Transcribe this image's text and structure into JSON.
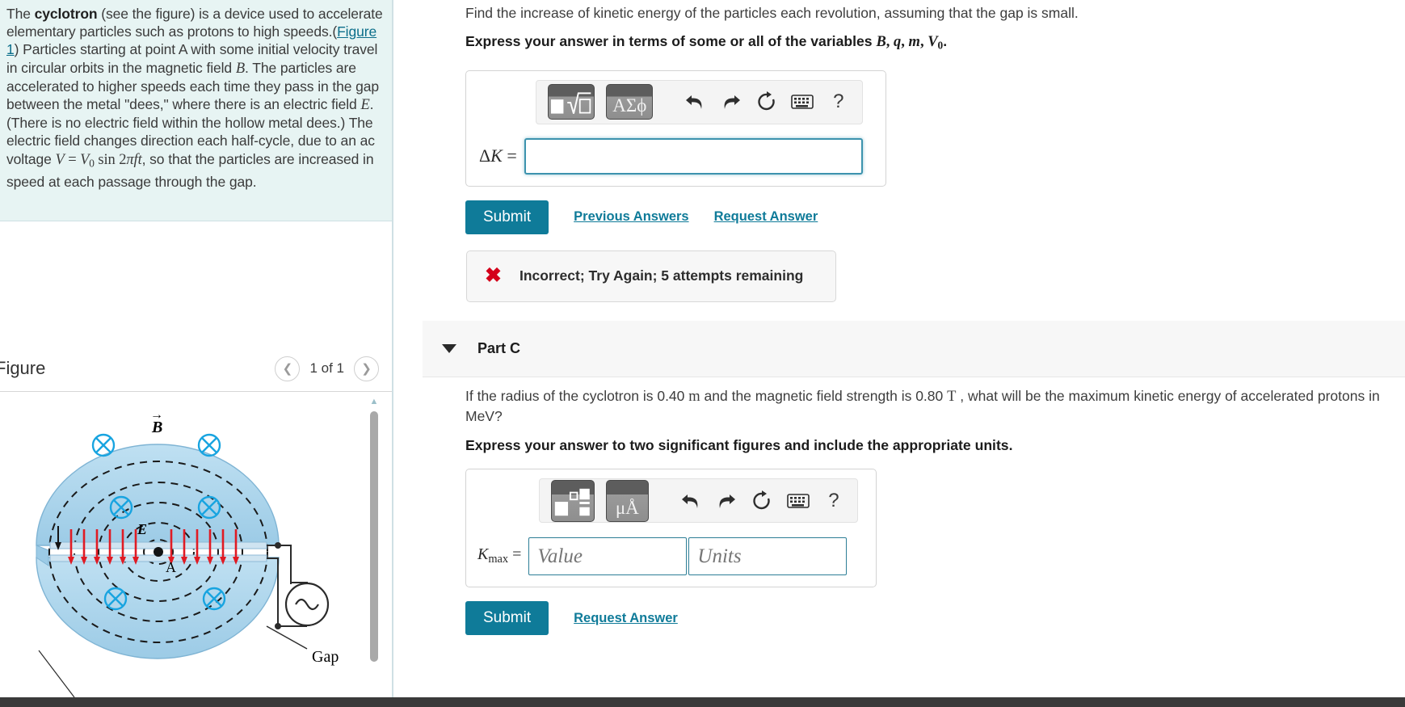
{
  "left": {
    "problem": {
      "intro_1": "The ",
      "bold_1": "cyclotron",
      "intro_2": " (see the figure) is a device used to accelerate elementary particles such as protons to high speeds.(",
      "figure_link": "Figure 1",
      "intro_3": ") Particles starting at point A with some initial velocity travel in circular orbits in the magnetic field ",
      "var_B": "B",
      "intro_4": ". The particles are accelerated to higher speeds each time they pass in the gap between the metal \"dees,\" where there is an electric field ",
      "var_E": "E",
      "intro_5": ". (There is no electric field within the hollow metal dees.) The electric field changes direction each half-cycle, due to an ac voltage ",
      "equation": "V = V0 sin 2πft",
      "intro_6": ", so that the particles are increased in speed at each passage through the gap."
    },
    "figure": {
      "title": "Figure",
      "prev_icon": "chevron-left-icon",
      "next_icon": "chevron-right-icon",
      "counter": "1 of 1",
      "labels": {
        "b_field": "B",
        "e_field": "E",
        "point_a": "A",
        "gap": "Gap"
      }
    }
  },
  "right": {
    "part_b": {
      "question": "Find the increase of kinetic energy of the particles each revolution, assuming that the gap is small.",
      "instruction_prefix": "Express your answer in terms of some or all of the variables ",
      "instruction_vars": "B, q, m, V0",
      "instruction_suffix": ".",
      "toolbar": {
        "template_button": "template-icon",
        "greek_button": "ΑΣϕ",
        "undo_icon": "undo-icon",
        "redo_icon": "redo-icon",
        "reset_icon": "reset-icon",
        "keyboard_icon": "keyboard-icon",
        "help_icon": "?"
      },
      "answer_label": "ΔK =",
      "answer_value": "",
      "answer_placeholder": "",
      "submit_label": "Submit",
      "previous_answers_label": "Previous Answers",
      "request_answer_label": "Request Answer",
      "feedback": {
        "icon": "x-mark-icon",
        "text": "Incorrect; Try Again; 5 attempts remaining"
      }
    },
    "part_c": {
      "caret_icon": "caret-down-icon",
      "title": "Part C",
      "question_1": "If the radius of the cyclotron is 0.40 ",
      "unit_m": "m",
      "question_2": " and the magnetic field strength is 0.80 ",
      "unit_t": "T",
      "question_3": " , what will be the maximum kinetic energy of accelerated protons in MeV?",
      "instruction": "Express your answer to two significant figures and include the appropriate units.",
      "toolbar": {
        "template_button": "template-icon",
        "units_button": "μÅ",
        "undo_icon": "undo-icon",
        "redo_icon": "redo-icon",
        "reset_icon": "reset-icon",
        "keyboard_icon": "keyboard-icon",
        "help_icon": "?"
      },
      "answer_label": "Kmax =",
      "value_placeholder": "Value",
      "value_current": "",
      "units_placeholder": "Units",
      "units_current": "",
      "submit_label": "Submit",
      "request_answer_label": "Request Answer"
    }
  },
  "colors": {
    "accent": "#0f7b99",
    "problem_bg": "#e7f4f3",
    "error": "#d4001a",
    "input_border": "#3d93ae",
    "figure_blue": "#a9d4ea"
  }
}
